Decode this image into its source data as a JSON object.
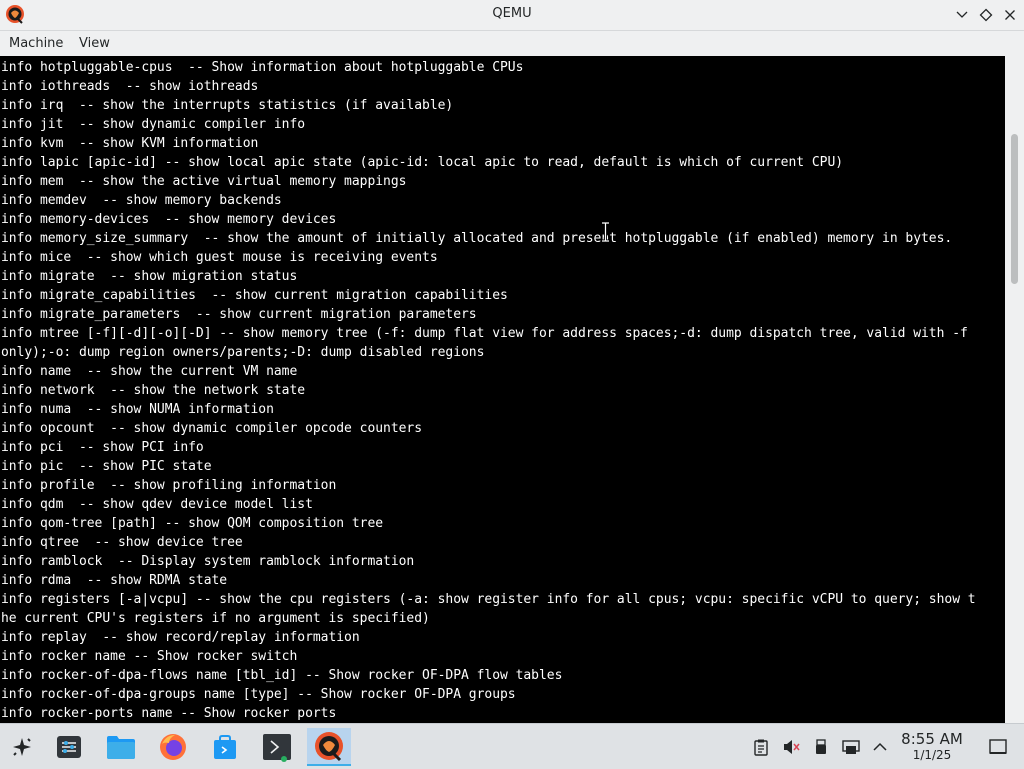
{
  "window": {
    "title": "QEMU"
  },
  "menu": {
    "machine": "Machine",
    "view": "View"
  },
  "console": {
    "lines": [
      "info hotpluggable-cpus  -- Show information about hotpluggable CPUs",
      "info iothreads  -- show iothreads",
      "info irq  -- show the interrupts statistics (if available)",
      "info jit  -- show dynamic compiler info",
      "info kvm  -- show KVM information",
      "info lapic [apic-id] -- show local apic state (apic-id: local apic to read, default is which of current CPU)",
      "info mem  -- show the active virtual memory mappings",
      "info memdev  -- show memory backends",
      "info memory-devices  -- show memory devices",
      "info memory_size_summary  -- show the amount of initially allocated and present hotpluggable (if enabled) memory in bytes.",
      "info mice  -- show which guest mouse is receiving events",
      "info migrate  -- show migration status",
      "info migrate_capabilities  -- show current migration capabilities",
      "info migrate_parameters  -- show current migration parameters",
      "info mtree [-f][-d][-o][-D] -- show memory tree (-f: dump flat view for address spaces;-d: dump dispatch tree, valid with -f",
      "only);-o: dump region owners/parents;-D: dump disabled regions",
      "info name  -- show the current VM name",
      "info network  -- show the network state",
      "info numa  -- show NUMA information",
      "info opcount  -- show dynamic compiler opcode counters",
      "info pci  -- show PCI info",
      "info pic  -- show PIC state",
      "info profile  -- show profiling information",
      "info qdm  -- show qdev device model list",
      "info qom-tree [path] -- show QOM composition tree",
      "info qtree  -- show device tree",
      "info ramblock  -- Display system ramblock information",
      "info rdma  -- show RDMA state",
      "info registers [-a|vcpu] -- show the cpu registers (-a: show register info for all cpus; vcpu: specific vCPU to query; show t",
      "he current CPU's registers if no argument is specified)",
      "info replay  -- show record/replay information",
      "info rocker name -- Show rocker switch",
      "info rocker-of-dpa-flows name [tbl_id] -- Show rocker OF-DPA flow tables",
      "info rocker-of-dpa-groups name [type] -- Show rocker OF-DPA groups",
      "info rocker-ports name -- Show rocker ports"
    ]
  },
  "taskbar": {
    "apps": [
      "application-launcher-icon",
      "system-settings-icon",
      "file-manager-icon",
      "firefox-icon",
      "discover-store-icon",
      "konsole-icon",
      "qemu-icon"
    ],
    "active_app": "qemu-icon",
    "clock_time": "8:55 AM",
    "clock_date": "1/1/25"
  },
  "colors": {
    "console_bg": "#000000",
    "console_text": "#ffffff",
    "chrome_bg": "#eff0f1",
    "taskbar_bg": "#dfe2e5",
    "accent": "#3daee9"
  }
}
